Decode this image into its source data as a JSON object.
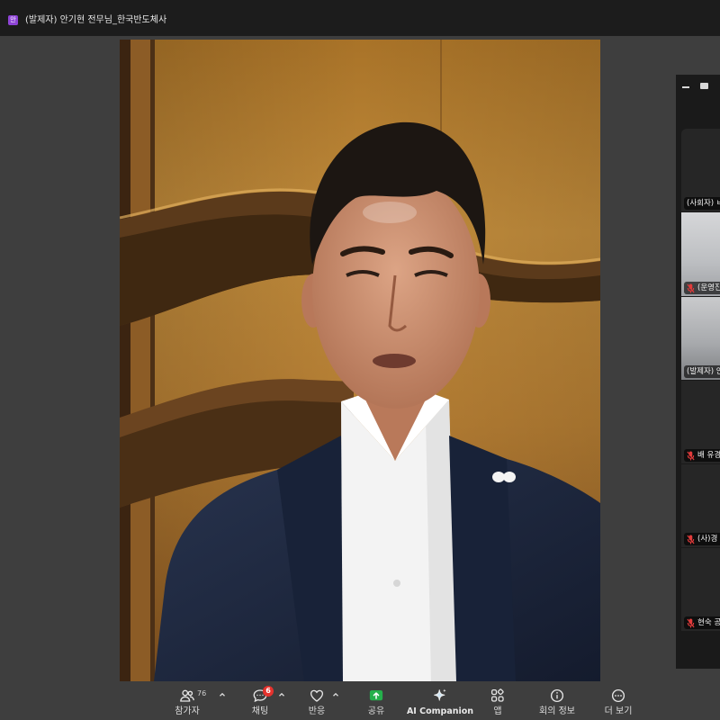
{
  "window": {
    "title": "(발제자) 안기현 전무님_한국반도체사",
    "title_icon_text": "안",
    "title_icon_color": "#8e44d6"
  },
  "gallery": {
    "controls": [
      {
        "icon": "minimize-icon"
      },
      {
        "icon": "gallery-view-icon"
      }
    ],
    "tiles": [
      {
        "label": "(사회자) ㅂ",
        "muted": false,
        "video_on": false,
        "icon": "mic-off-icon"
      },
      {
        "label": "(운영진",
        "muted": true,
        "video_on": true,
        "icon": "mic-off-icon"
      },
      {
        "label": "(발제자) 안",
        "muted": false,
        "video_on": true,
        "icon": "mic-off-icon"
      },
      {
        "label": "배 유경",
        "muted": true,
        "video_on": false,
        "icon": "mic-off-icon"
      },
      {
        "label": "(사)경",
        "muted": true,
        "video_on": false,
        "icon": "mic-off-icon"
      },
      {
        "label": "현숙 공",
        "muted": true,
        "video_on": false,
        "icon": "mic-off-icon"
      }
    ]
  },
  "toolbar": {
    "participants": {
      "label": "참가자",
      "count": "76",
      "icon": "participants-icon"
    },
    "chat": {
      "label": "채팅",
      "badge": "6",
      "icon": "chat-icon"
    },
    "reactions": {
      "label": "반응",
      "icon": "heart-icon"
    },
    "share": {
      "label": "공유",
      "icon": "share-screen-icon"
    },
    "ai_companion": {
      "label": "AI Companion",
      "icon": "ai-sparkle-icon"
    },
    "apps": {
      "label": "앱",
      "icon": "apps-icon"
    },
    "meeting_info": {
      "label": "회의 정보",
      "icon": "info-icon"
    },
    "more": {
      "label": "더 보기",
      "icon": "more-icon"
    }
  },
  "colors": {
    "background": "#3e3e3e",
    "titlebar": "#1c1c1c",
    "gallery_panel": "#1a1a1a",
    "share_green": "#24b04b",
    "badge_red": "#e5322d",
    "muted_red": "#e23b3b",
    "toolbar_text": "#dcdcdc"
  }
}
